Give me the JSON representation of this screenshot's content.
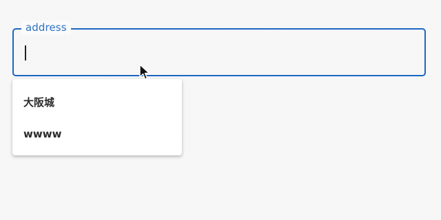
{
  "field": {
    "label": "address",
    "value": "",
    "accent_color": "#1a66c2"
  },
  "suggestions": [
    {
      "label": "大阪城"
    },
    {
      "label": "wwww"
    }
  ],
  "pointer": {
    "icon": "arrow-cursor-icon"
  }
}
